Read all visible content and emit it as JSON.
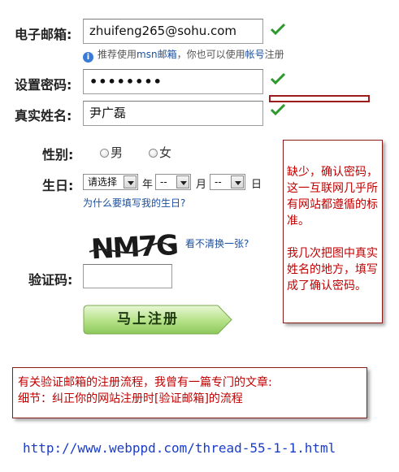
{
  "form": {
    "email": {
      "label": "电子邮箱:",
      "value": "zhuifeng265@sohu.com"
    },
    "email_hint": {
      "prefix": "推荐使用",
      "msn": "msn邮箱",
      "middle": "，你也可以使用",
      "account": "帐号",
      "suffix": "注册"
    },
    "password": {
      "label": "设置密码:",
      "value": "••••••••"
    },
    "realname": {
      "label": "真实姓名:",
      "value": "尹广磊"
    },
    "gender": {
      "label": "性别:",
      "options": [
        "男",
        "女"
      ]
    },
    "birthday": {
      "label": "生日:",
      "year_select": "请选择",
      "year_unit": "年",
      "month_select": "--",
      "month_unit": "月",
      "day_select": "--",
      "day_unit": "日",
      "why_link": "为什么要填写我的生日?"
    },
    "captcha": {
      "image_text": "NM7G",
      "refresh_link": "看不清换一张?"
    },
    "verify": {
      "label": "验证码:",
      "value": ""
    },
    "submit_label": "马上注册"
  },
  "notes": {
    "right_note_p1": "缺少，确认密码，这一互联网几乎所有网站都遵循的标准。",
    "right_note_p2": "我几次把图中真实姓名的地方，填写成了确认密码。",
    "bottom_note_line1": "有关验证邮箱的注册流程，我曾有一篇专门的文章:",
    "bottom_note_line2": "细节：纠正你的网站注册时[验证邮箱]的流程"
  },
  "footer": {
    "url": "http://www.webppd.com/thread-55-1-1.html"
  },
  "colors": {
    "check_green": "#2e9a2e",
    "note_red": "#c00000",
    "link_blue": "#1a4fa0",
    "button_green": "#9fd36a"
  }
}
